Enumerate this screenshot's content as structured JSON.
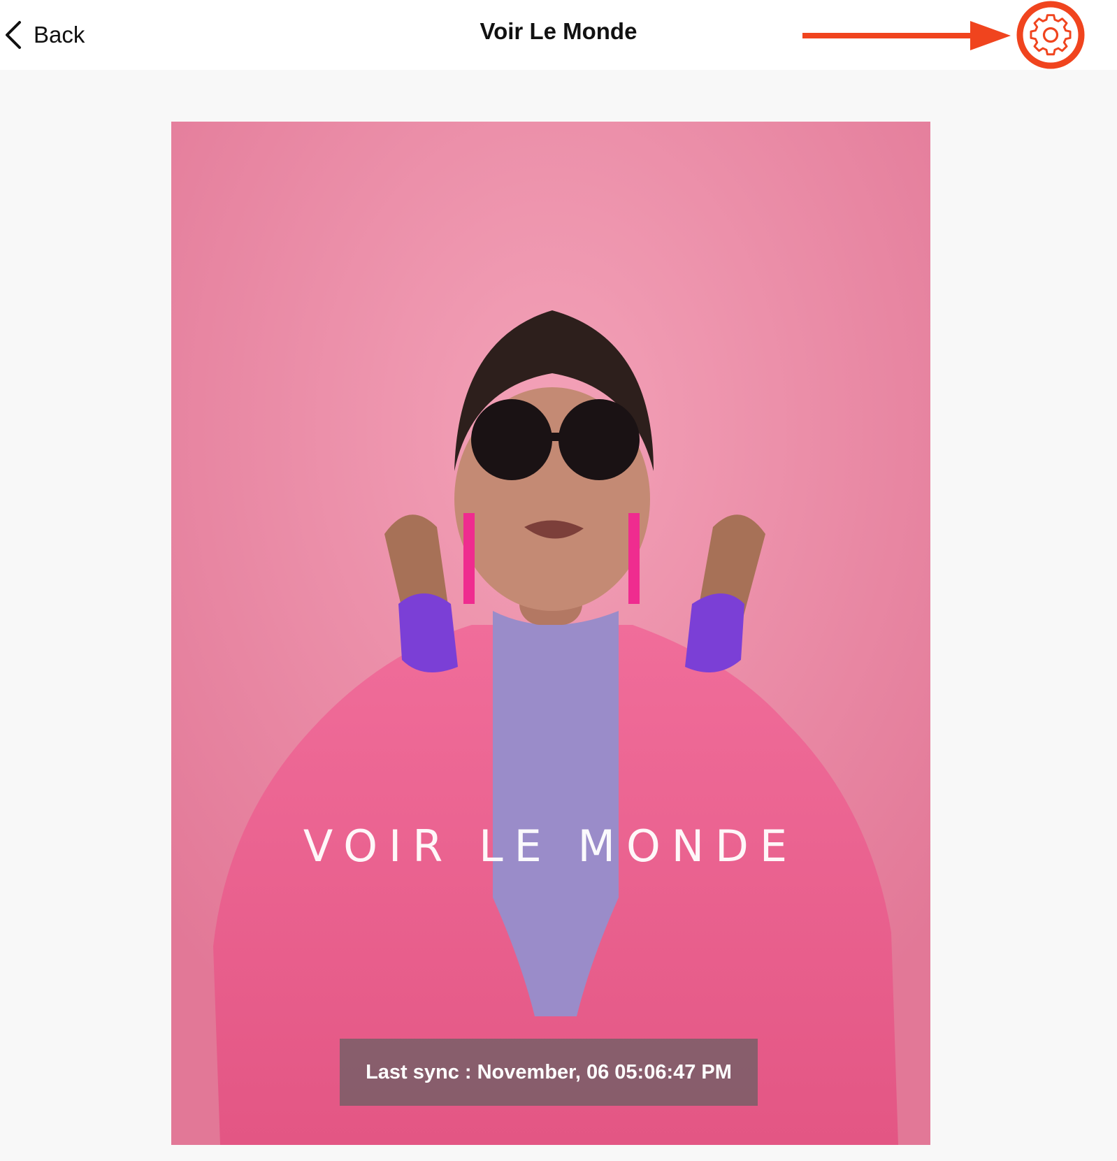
{
  "header": {
    "back_label": "Back",
    "title": "Voir Le Monde",
    "settings_icon": "gear-icon"
  },
  "annotation": {
    "color": "#f0441e",
    "arrow_icon": "arrow-right-icon"
  },
  "banner": {
    "brand_text": "VOIR LE MONDE",
    "sync_text": "Last sync : November, 06 05:06:47 PM",
    "background_color": "#eb8aa5"
  }
}
